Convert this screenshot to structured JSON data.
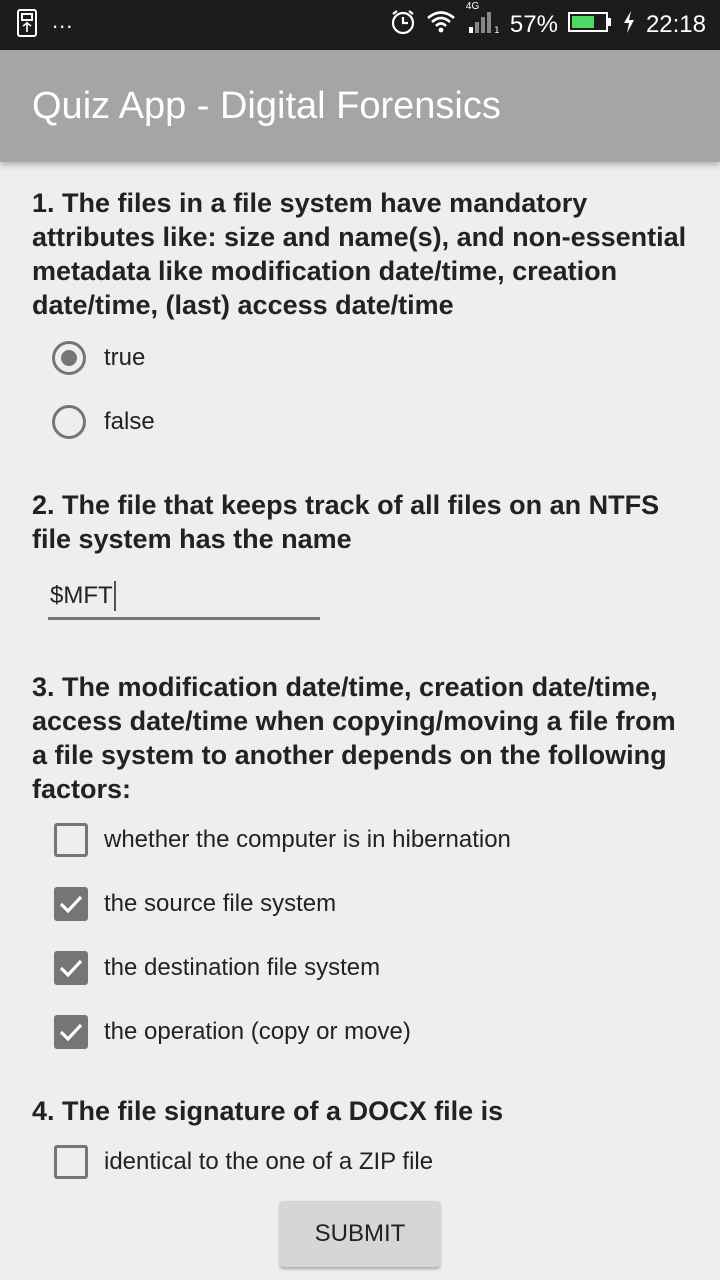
{
  "status_bar": {
    "battery_percent": "57%",
    "network": "4G",
    "time": "22:18",
    "dots": "..."
  },
  "app": {
    "title": "Quiz App - Digital Forensics"
  },
  "questions": [
    {
      "text": "1. The files in a file system have mandatory attributes like: size and name(s), and non-essential metadata like modification date/time, creation date/time, (last) access date/time",
      "options": [
        {
          "label": "true",
          "selected": true
        },
        {
          "label": "false",
          "selected": false
        }
      ]
    },
    {
      "text": "2. The file that keeps track of all files on an NTFS file system has the name",
      "answer_value": "$MFT"
    },
    {
      "text": "3. The modification date/time, creation date/time, access date/time when copying/moving a file from a file system to another depends on the following factors:",
      "options": [
        {
          "label": "whether the computer is in hibernation",
          "checked": false
        },
        {
          "label": "the source file system",
          "checked": true
        },
        {
          "label": "the destination file system",
          "checked": true
        },
        {
          "label": "the operation (copy or move)",
          "checked": true
        }
      ]
    },
    {
      "text": "4. The file signature of a DOCX file is",
      "options": [
        {
          "label": "identical to the one of a ZIP file",
          "checked": false
        }
      ]
    }
  ],
  "submit_label": "SUBMIT",
  "colors": {
    "toolbar": "#a5a5a5",
    "background": "#eeeeee",
    "control": "#757575",
    "status_bar": "#1c1c1c"
  }
}
